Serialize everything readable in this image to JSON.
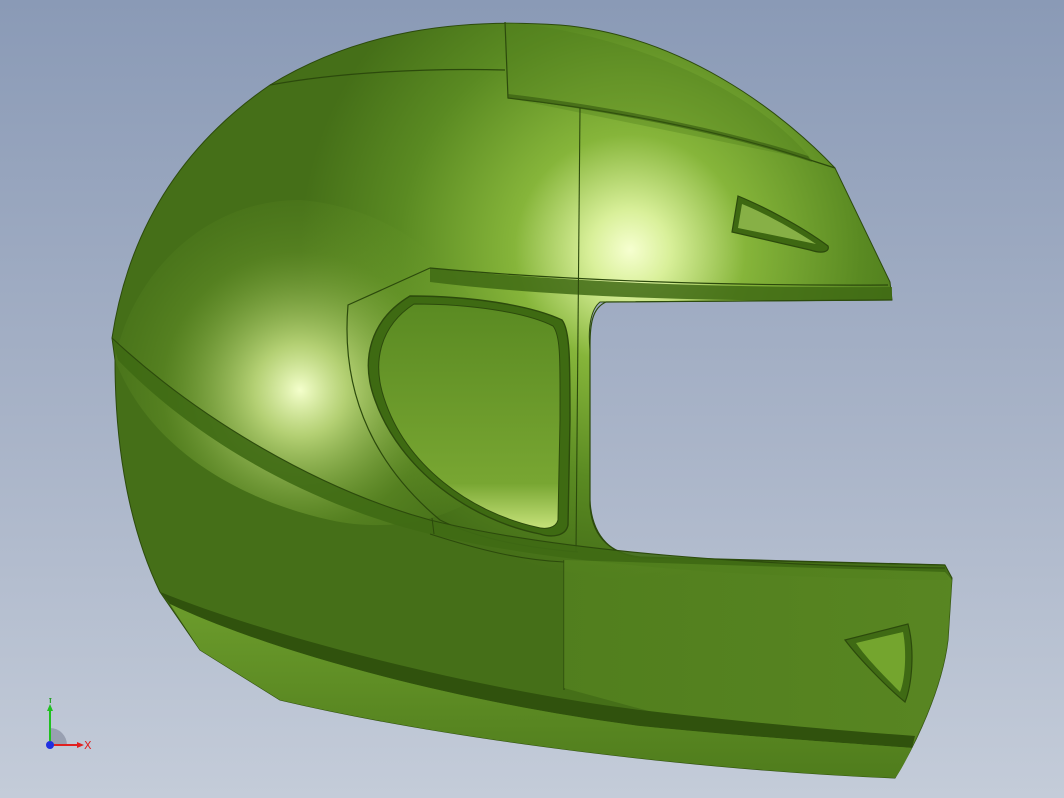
{
  "viewport": {
    "background_top": "#8a9ab6",
    "background_bottom": "#c4ccd9"
  },
  "model": {
    "color_base": "#5a8a22",
    "color_highlight": "#f4ffcc",
    "color_shadow": "#3e6514"
  },
  "triad": {
    "x_label": "X",
    "y_label": "Y",
    "x_color": "#e02020",
    "y_color": "#20c020",
    "z_color": "#2030e0"
  }
}
